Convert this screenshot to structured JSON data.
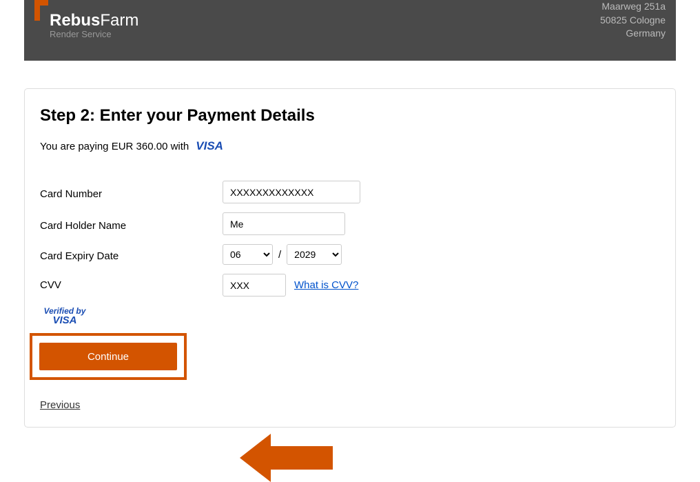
{
  "header": {
    "brand_main": "Rebus",
    "brand_sub": "Farm",
    "brand_tagline": "Render Service",
    "address_line1": "Maarweg 251a",
    "address_line2": "50825 Cologne",
    "address_line3": "Germany"
  },
  "step_title": "Step 2: Enter your Payment Details",
  "paying_text": "You are paying EUR 360.00 with",
  "visa_text": "VISA",
  "form": {
    "card_number_label": "Card Number",
    "card_number_value": "XXXXXXXXXXXXX",
    "card_holder_label": "Card Holder Name",
    "card_holder_value": "Me",
    "expiry_label": "Card Expiry Date",
    "expiry_month": "06",
    "expiry_sep": "/",
    "expiry_year": "2029",
    "cvv_label": "CVV",
    "cvv_value": "XXX",
    "cvv_link": "What is CVV?"
  },
  "verified_top": "Verified by",
  "verified_bottom": "VISA",
  "continue_label": "Continue",
  "previous_label": "Previous"
}
